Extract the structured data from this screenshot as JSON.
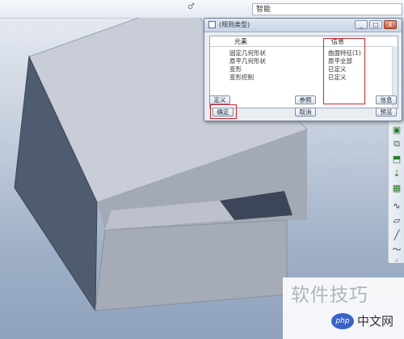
{
  "toolbar": {
    "search_value": "智能",
    "marker": "♂"
  },
  "dialog": {
    "title": "(规则类型)",
    "window_buttons": [
      "_",
      "□",
      "X"
    ],
    "columns": {
      "element": "元素",
      "info": "信息"
    },
    "rows": [
      {
        "element": "固定几何形状",
        "info": "曲面特征(1)"
      },
      {
        "element": "原平几何形状",
        "info": "原平全部"
      },
      {
        "element": "变形",
        "info": "已定义"
      },
      {
        "element": "变形控制",
        "info": "已定义"
      }
    ],
    "buttons": {
      "define": "定义",
      "reference": "参照",
      "info": "信息",
      "confirm": "确定",
      "cancel": "取消",
      "preview": "预览"
    }
  },
  "tools": [
    {
      "icon": "green-shape-icon"
    },
    {
      "icon": "green-copy-icon"
    },
    {
      "icon": "green-extrude-icon"
    },
    {
      "icon": "green-arrow-icon"
    },
    {
      "icon": "green-pattern-icon"
    },
    {
      "icon": "wave-icon"
    },
    {
      "icon": "parallelogram-icon"
    },
    {
      "icon": "slash-icon"
    },
    {
      "icon": "curve-icon"
    },
    {
      "icon": "dots-icon"
    }
  ],
  "watermark": {
    "caption": "软件技巧",
    "logo": "php",
    "site": "中文网"
  },
  "colors": {
    "highlight": "#d8232a",
    "dialog_bg": "#eaeef3"
  }
}
